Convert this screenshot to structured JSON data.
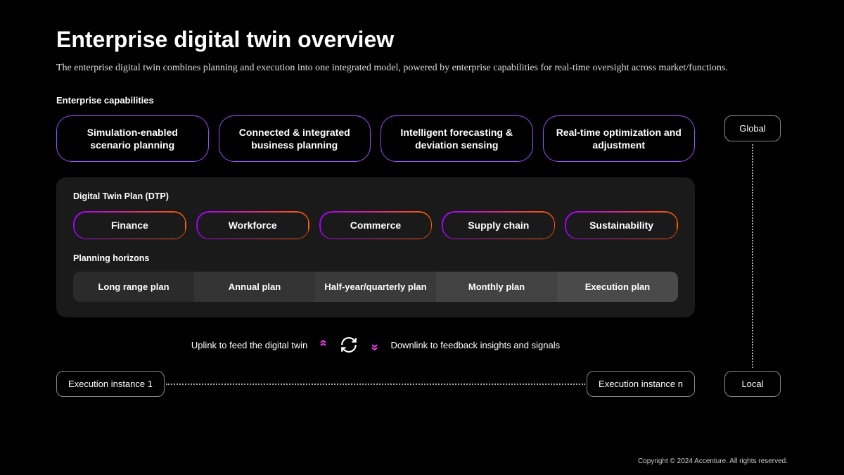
{
  "title": "Enterprise digital twin overview",
  "subtitle": "The enterprise digital twin combines planning and execution into one integrated model, powered by enterprise capabilities for real-time oversight across market/functions.",
  "capabilities": {
    "label": "Enterprise capabilities",
    "items": [
      "Simulation-enabled scenario planning",
      "Connected & integrated business planning",
      "Intelligent forecasting & deviation sensing",
      "Real-time optimization and adjustment"
    ]
  },
  "dtp": {
    "label": "Digital Twin Plan (DTP)",
    "items": [
      "Finance",
      "Workforce",
      "Commerce",
      "Supply chain",
      "Sustainability"
    ]
  },
  "horizons": {
    "label": "Planning horizons",
    "items": [
      "Long range plan",
      "Annual plan",
      "Half-year/quarterly plan",
      "Monthly plan",
      "Execution plan"
    ]
  },
  "links": {
    "uplink": "Uplink to feed the digital twin",
    "downlink": "Downlink to feedback insights and signals"
  },
  "execution": {
    "left": "Execution instance 1",
    "right": "Execution instance n"
  },
  "scope": {
    "top": "Global",
    "bottom": "Local"
  },
  "copyright": "Copyright © 2024 Accenture. All rights reserved."
}
